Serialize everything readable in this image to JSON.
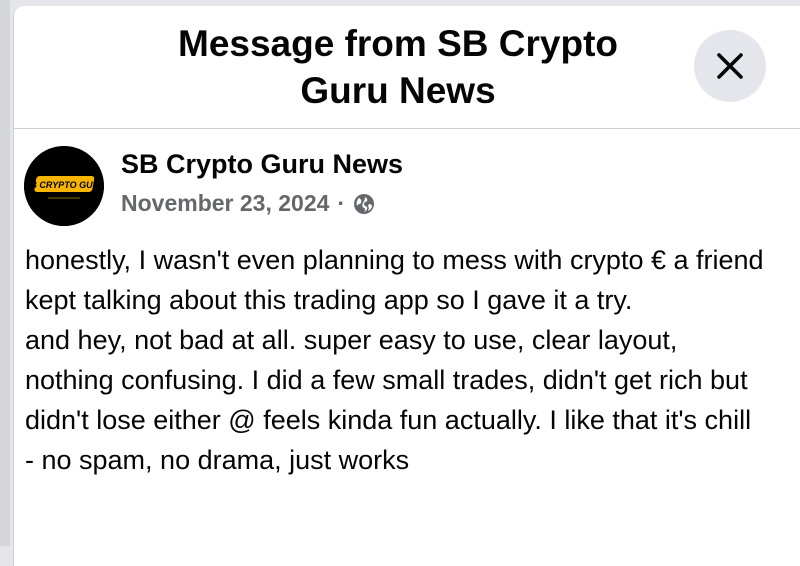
{
  "dialog": {
    "title_line1": "Message from SB Crypto",
    "title_line2": "Guru News",
    "close_icon": "close-icon"
  },
  "post": {
    "author": "SB Crypto Guru News",
    "avatar_logo_text": "SB CRYPTO GURU",
    "date": "November 23, 2024",
    "separator": "·",
    "audience_icon": "globe-icon",
    "paragraph1": "honestly, I wasn't even planning to mess with crypto € a friend kept talking about this trading app so I gave it a try.",
    "paragraph2": "and hey, not bad at all. super easy to use, clear layout, nothing confusing. I did a few small trades, didn't get rich but didn't lose either @ feels kinda fun actually. I like that it's chill - no spam, no drama, just works"
  },
  "colors": {
    "page_background": "#e4e6eb",
    "dialog_background": "#ffffff",
    "primary_text": "#050505",
    "secondary_text": "#65676b",
    "close_button_background": "#e4e6eb",
    "avatar_accent": "#f7b500"
  }
}
